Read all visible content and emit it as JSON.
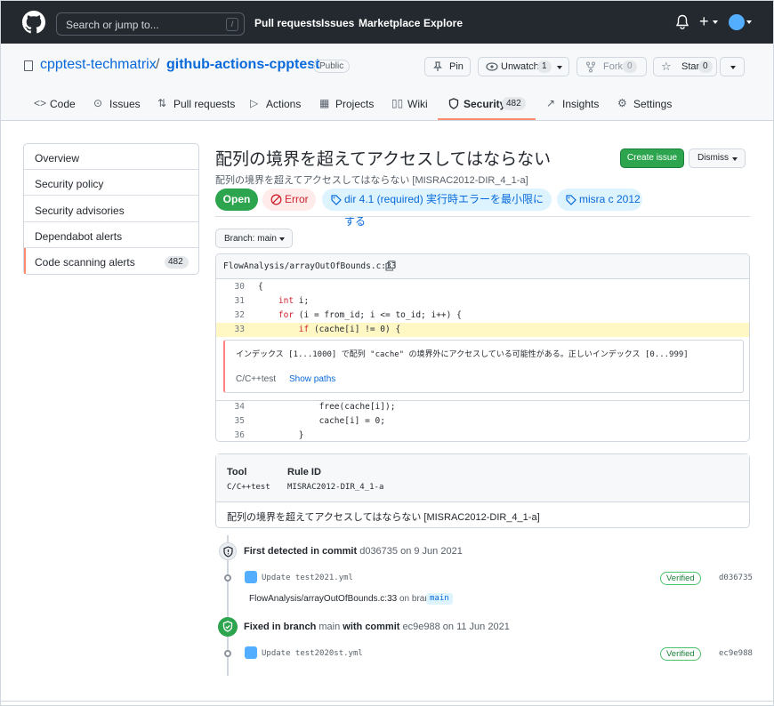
{
  "topbar": {
    "search_placeholder": "Search or jump to...",
    "search_shortcut": "/",
    "nav": [
      "Pull requests",
      "Issues",
      "Marketplace",
      "Explore"
    ],
    "plus": "+"
  },
  "repo": {
    "owner": "cpptest-techmatrix",
    "separator": "/",
    "name": "github-actions-cpptest",
    "visibility": "Public",
    "pin_label": "Pin",
    "unwatch_label": "Unwatch",
    "unwatch_count": "1",
    "fork_label": "Fork",
    "fork_count": "0",
    "star_label": "Star",
    "star_count": "0"
  },
  "tabs": [
    {
      "label": "Code"
    },
    {
      "label": "Issues"
    },
    {
      "label": "Pull requests"
    },
    {
      "label": "Actions"
    },
    {
      "label": "Projects"
    },
    {
      "label": "Wiki"
    },
    {
      "label": "Security",
      "count": "482"
    },
    {
      "label": "Insights"
    },
    {
      "label": "Settings"
    }
  ],
  "sidebar": {
    "items": [
      {
        "label": "Overview"
      },
      {
        "label": "Security policy"
      },
      {
        "label": "Security advisories"
      },
      {
        "label": "Dependabot alerts"
      },
      {
        "label": "Code scanning alerts",
        "count": "482"
      }
    ]
  },
  "alert": {
    "title": "配列の境界を超えてアクセスしてはならない",
    "subtitle": "配列の境界を超えてアクセスしてはならない [MISRAC2012-DIR_4_1-a]",
    "create_issue": "Create issue",
    "dismiss": "Dismiss",
    "status": "Open",
    "severity": "Error",
    "tag1": "dir 4.1 (required) 実行時エラーを最小限にする",
    "tag2": "misra c 2012",
    "branch_button": "Branch: main"
  },
  "code": {
    "file_path": "FlowAnalysis/arrayOutOfBounds.c:33",
    "lines_before": [
      {
        "n": "30",
        "pre": "{",
        "kw": "",
        "post": ""
      },
      {
        "n": "31",
        "pre": "    ",
        "kw": "int",
        "post": " i;"
      },
      {
        "n": "32",
        "pre": "    ",
        "kw": "for",
        "post": " (i = from_id; i <= to_id; i++) {"
      },
      {
        "n": "33",
        "pre": "        ",
        "kw": "if",
        "post": " (cache[i] != 0) {"
      }
    ],
    "message": "インデックス [1...1000] で配列 \"cache\" の境界外にアクセスしている可能性がある。正しいインデックス [0...999]",
    "tool": "C/C++test",
    "show_paths": "Show paths",
    "lines_after": [
      {
        "n": "34",
        "text": "            free(cache[i]);"
      },
      {
        "n": "35",
        "text": "            cache[i] = 0;"
      },
      {
        "n": "36",
        "text": "        }"
      }
    ]
  },
  "rule_info": {
    "tool_label": "Tool",
    "tool_value": "C/C++test",
    "rule_label": "Rule ID",
    "rule_value": "MISRAC2012-DIR_4_1-a",
    "description": "配列の境界を超えてアクセスしてはならない [MISRAC2012-DIR_4_1-a]"
  },
  "timeline": {
    "first_prefix": "First detected in commit",
    "first_sha": "d036735",
    "first_suffix": "on 9 Jun 2021",
    "commit1_msg": "Update test2021.yml",
    "commit1_verified": "Verified",
    "commit1_sha": "d036735",
    "location_dir": "FlowAnalysis/",
    "location_file": "arrayOutOfBounds.c:33",
    "location_on": "on branch",
    "location_branch": "main",
    "fixed_prefix": "Fixed in branch",
    "fixed_branch": "main",
    "fixed_mid": "with commit",
    "fixed_sha": "ec9e988",
    "fixed_suffix": "on 11 Jun 2021",
    "commit2_msg": "Update test2020st.yml",
    "commit2_verified": "Verified",
    "commit2_sha": "ec9e988"
  },
  "colors": {
    "header_bg": "#24292f",
    "accent_green": "#2da44e",
    "link_blue": "#0969da",
    "error_red": "#cf222e",
    "highlight": "#fff8c5"
  }
}
